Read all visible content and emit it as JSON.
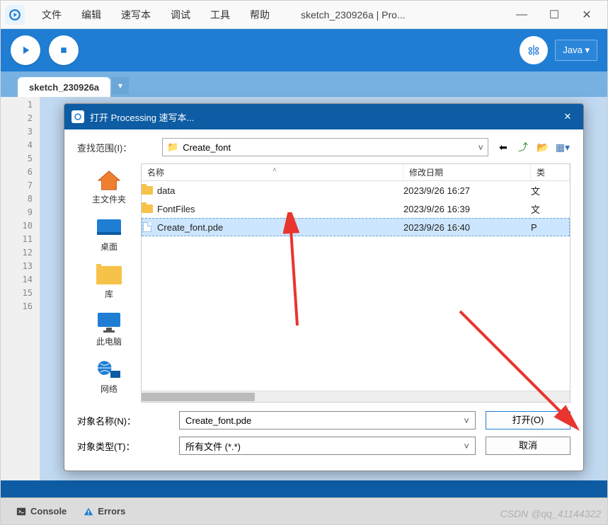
{
  "window": {
    "menus": [
      "文件",
      "编辑",
      "速写本",
      "调试",
      "工具",
      "帮助"
    ],
    "title": "sketch_230926a | Pro...",
    "lang": "Java"
  },
  "tabs": {
    "active": "sketch_230926a"
  },
  "editor": {
    "line_count": 16
  },
  "footer": {
    "console": "Console",
    "errors": "Errors"
  },
  "watermark": "CSDN @qq_41144322",
  "dialog": {
    "title": "打开 Processing 速写本...",
    "look_in_label": "查找范围(I)：",
    "look_in_value": "Create_font",
    "columns": {
      "name": "名称",
      "date": "修改日期",
      "extra": "类"
    },
    "files": [
      {
        "name": "data",
        "type": "folder",
        "date": "2023/9/26 16:27",
        "extra": "文"
      },
      {
        "name": "FontFiles",
        "type": "folder",
        "date": "2023/9/26 16:39",
        "extra": "文"
      },
      {
        "name": "Create_font.pde",
        "type": "file",
        "date": "2023/9/26 16:40",
        "extra": "P",
        "selected": true
      }
    ],
    "places": {
      "home": "主文件夹",
      "desktop": "桌面",
      "library": "库",
      "thispc": "此电脑",
      "network": "网络"
    },
    "filename_label": "对象名称(N)：",
    "filename_value": "Create_font.pde",
    "filetype_label": "对象类型(T)：",
    "filetype_value": "所有文件 (*.*)",
    "open_btn": "打开(O)",
    "cancel_btn": "取消"
  }
}
